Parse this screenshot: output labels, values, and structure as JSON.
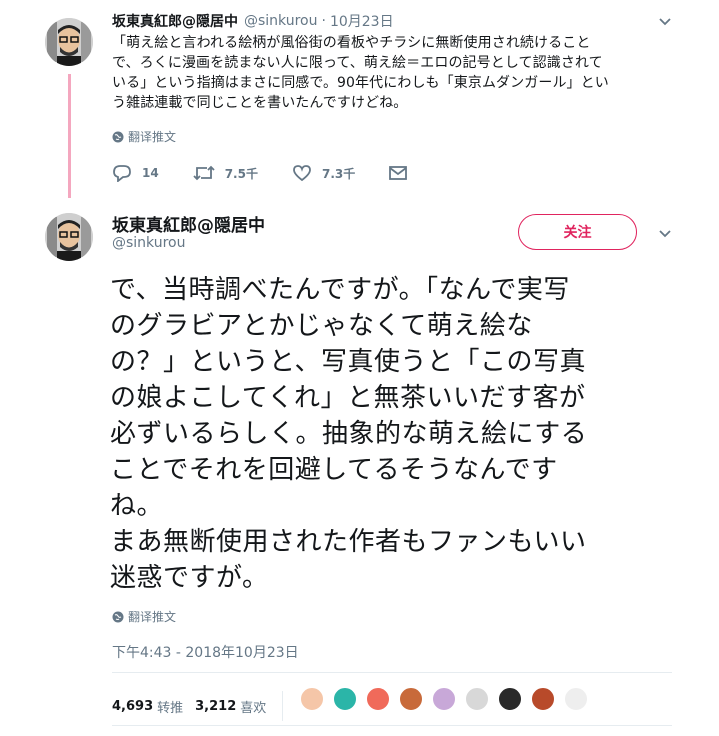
{
  "parent_tweet": {
    "name": "坂東真紅郎@隠居中",
    "handle": "@sinkurou",
    "dot": "·",
    "date": "10月23日",
    "text_lines": [
      "「萌え絵と言われる絵柄が風俗街の看板やチラシに無断使用され続けること",
      "で、ろくに漫画を読まない人に限って、萌え絵＝エロの記号として認識されて",
      "いる」という指摘はまさに同感で。90年代にわしも「東京ムダンガール」とい",
      "う雑誌連載で同じことを書いたんですけどね。"
    ],
    "translate_label": "翻译推文",
    "reply_count": "14",
    "retweet_count": "7.5千",
    "like_count": "7.3千"
  },
  "main_tweet": {
    "name": "坂東真紅郎@隠居中",
    "handle": "@sinkurou",
    "follow_label": "关注",
    "text_lines": [
      "で、当時調べたんですが。「なんで実写",
      "のグラビアとかじゃなくて萌え絵な",
      "の？」というと、写真使うと「この写真",
      "の娘よこしてくれ」と無茶いいだす客が",
      "必ずいるらしく。抽象的な萌え絵にする",
      "ことでそれを回避してるそうなんです",
      "ね。",
      "まあ無断使用された作者もファンもいい",
      "迷惑ですが。"
    ],
    "translate_label": "翻译推文",
    "timestamp": "下午4:43 - 2018年10月23日",
    "retweets_num": "4,693",
    "retweets_label": "转推",
    "likes_num": "3,212",
    "likes_label": "喜欢"
  },
  "colors": {
    "accent": "#e0245e",
    "thread_line": "#f4a7bf",
    "secondary_text": "#657786",
    "primary_text": "#14171a"
  },
  "icons": [
    "reply-icon",
    "retweet-icon",
    "like-icon",
    "dm-icon",
    "globe-icon",
    "chevron-down-icon"
  ]
}
